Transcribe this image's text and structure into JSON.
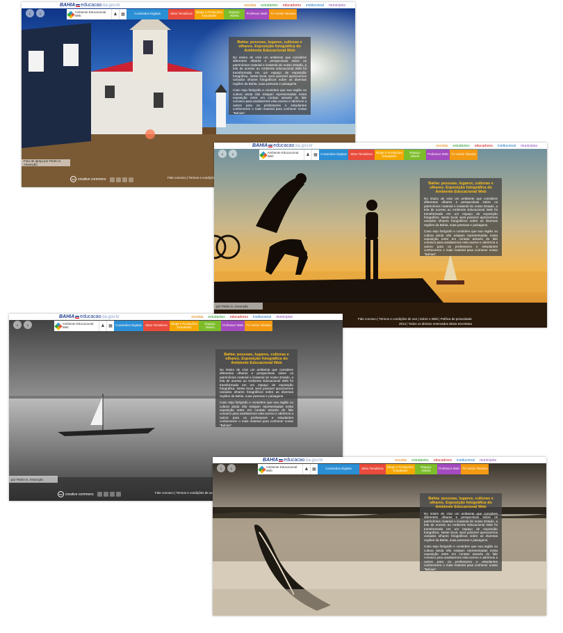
{
  "brand": {
    "bahia": "BAHIA",
    "edu": "educacao",
    "gov": ".ba.gov.br"
  },
  "top_links": [
    {
      "label": "escolas",
      "color": "#e07b00"
    },
    {
      "label": "estudantes",
      "color": "#2a9a2a"
    },
    {
      "label": "educadores",
      "color": "#cc1111"
    },
    {
      "label": "institucional",
      "color": "#1e77c9"
    },
    {
      "label": "municípios",
      "color": "#8a4bb5"
    }
  ],
  "logo_text": "Ambiente Educacional Web",
  "nav_items": [
    {
      "label": "Conteúdos Digitais",
      "color": "#2b8fd6"
    },
    {
      "label": "Sites Temáticos",
      "color": "#e94b3c"
    },
    {
      "label": "Blogs e Produções Estudantis",
      "color": "#f5a800"
    },
    {
      "label": "Espaço Aberto",
      "color": "#7dbd2a"
    },
    {
      "label": "Professor Web",
      "color": "#a44bbf"
    },
    {
      "label": "TV Anísio Teixeira",
      "color": "#f39a12"
    }
  ],
  "panel": {
    "title": "Bahia: pessoas, lugares, culturas e olhares. Exposição fotográfica do Ambiente Educacional Web",
    "p1": "No intuito de criar um ambiente que considere diferentes olhares e perspectivas sobre os patrimônios material e imaterial do nosso Estado, a tela de acesso ao Ambiente Educacional Web foi transformada em um espaço de exposição fotográfica. Neste local, será possível apreciarmos variados olhares fotográficos sobre as diversas regiões da Bahia, suas pessoas e paisagens.",
    "p2": "Caso seja fotógrafo e considere que sua região ou cultura ainda não estejam representadas nesta exposição entre em contato através do fale conosco para analisarmos esta acervo e abrirmos a outros para os professores e estudantes conhecerem o mais material para conhecer nossa \"Bahias\"."
  },
  "footer": {
    "links": "Fale conosco  |  Termos e condições de uso  |  Sobre o Web  |  Política de privacidade",
    "copyright": "2013 | Todos os direitos reservados desta Secretaria"
  },
  "cc_label": "creative commons",
  "screenshots": [
    {
      "credit": "Foto de Igreja por Pedro S. Assunção",
      "theme": "church"
    },
    {
      "credit": "por Pedro S. Assunção",
      "theme": "capoeira"
    },
    {
      "credit": "por Pedro S. Assunção",
      "theme": "sailboat"
    },
    {
      "credit": "",
      "theme": "canoe"
    }
  ]
}
